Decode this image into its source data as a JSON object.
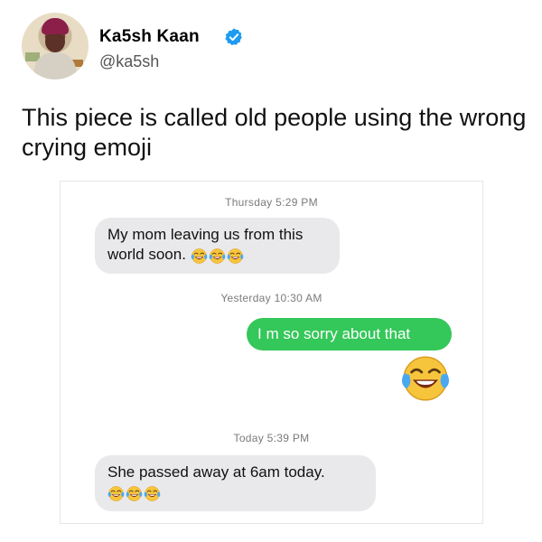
{
  "tweet": {
    "display_name": "Ka5sh  Kaan",
    "handle": "@ka5sh",
    "text": "This piece is called old people using the wrong crying emoji"
  },
  "chat": {
    "timestamps": [
      "Thursday 5:29 PM",
      "Yesterday 10:30 AM",
      "Today 5:39 PM"
    ],
    "messages": [
      {
        "side": "received",
        "text": "My mom leaving us from this world soon.",
        "emoji": "face-with-tears-of-joy",
        "emoji_count": 3
      },
      {
        "side": "sent",
        "text": "I m so sorry about that",
        "emoji": "face-with-tears-of-joy",
        "emoji_count": 1
      },
      {
        "side": "received",
        "text": "She passed away at 6am today.",
        "emoji": "face-with-tears-of-joy",
        "emoji_count": 3
      }
    ]
  },
  "colors": {
    "sent_bubble": "#34c759",
    "received_bubble": "#e9e9eb",
    "verified_badge": "#1d9bf0",
    "emoji_face": "#f7c53c"
  },
  "icons": {
    "verified": "verified-badge-icon",
    "emoji": "face-with-tears-of-joy-icon"
  }
}
